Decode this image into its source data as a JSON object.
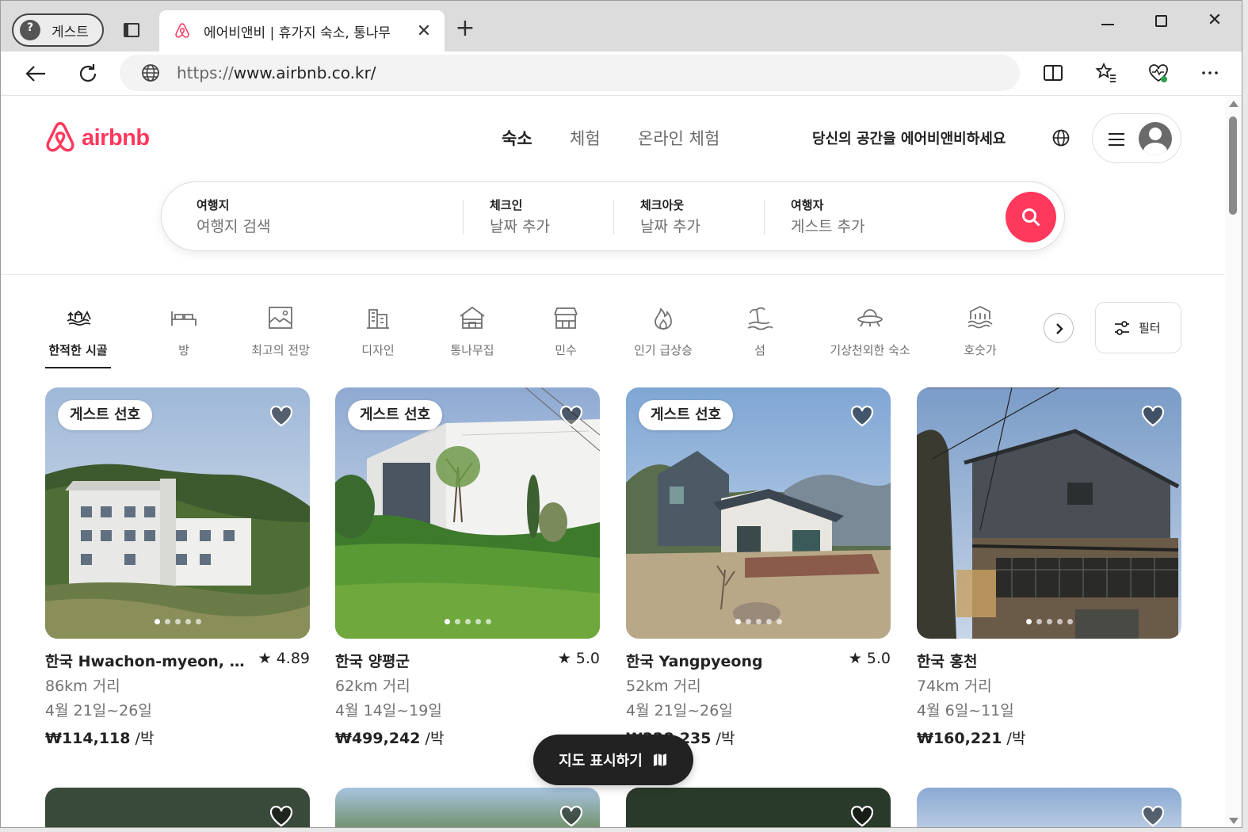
{
  "browser": {
    "profile_label": "게스트",
    "tab_title": "에어비앤비 | 휴가지 숙소, 통나무",
    "url_prefix": "https://",
    "url_main": "www.airbnb.co.kr/"
  },
  "header": {
    "logo_text": "airbnb",
    "nav": [
      "숙소",
      "체험",
      "온라인 체험"
    ],
    "host_link": "당신의 공간을 에어비앤비하세요"
  },
  "search": {
    "segments": [
      {
        "label": "여행지",
        "value": "여행지 검색"
      },
      {
        "label": "체크인",
        "value": "날짜 추가"
      },
      {
        "label": "체크아웃",
        "value": "날짜 추가"
      },
      {
        "label": "여행자",
        "value": "게스트 추가"
      }
    ]
  },
  "categories": [
    {
      "label": "한적한 시골",
      "icon": "countryside-icon",
      "active": true
    },
    {
      "label": "방",
      "icon": "bed-icon"
    },
    {
      "label": "최고의 전망",
      "icon": "view-icon"
    },
    {
      "label": "디자인",
      "icon": "design-icon"
    },
    {
      "label": "통나무집",
      "icon": "cabin-icon"
    },
    {
      "label": "민수",
      "icon": "minsu-icon"
    },
    {
      "label": "인기 급상승",
      "icon": "flame-icon"
    },
    {
      "label": "섬",
      "icon": "island-icon"
    },
    {
      "label": "기상천외한 숙소",
      "icon": "ufo-icon"
    },
    {
      "label": "호숫가",
      "icon": "lake-icon"
    }
  ],
  "filter_label": "필터",
  "listings": [
    {
      "badge": "게스트 선호",
      "title": "한국 Hwachon-myeon, Hongcheon",
      "rating": "4.89",
      "distance": "86km 거리",
      "dates": "4월 21일~26일",
      "price": "₩114,118",
      "per": " /박"
    },
    {
      "badge": "게스트 선호",
      "title": "한국 양평군",
      "rating": "5.0",
      "distance": "62km 거리",
      "dates": "4월 14일~19일",
      "price": "₩499,242",
      "per": " /박"
    },
    {
      "badge": "게스트 선호",
      "title": "한국 Yangpyeong",
      "rating": "5.0",
      "distance": "52km 거리",
      "dates": "4월 21일~26일",
      "price": "₩228,235",
      "per": " /박"
    },
    {
      "badge": "",
      "title": "한국 홍천",
      "rating": "",
      "distance": "74km 거리",
      "dates": "4월 6일~11일",
      "price": "₩160,221",
      "per": " /박"
    }
  ],
  "map_button": "지도 표시하기",
  "colors": {
    "brand": "#ff385c",
    "text": "#222222",
    "muted": "#717171"
  }
}
